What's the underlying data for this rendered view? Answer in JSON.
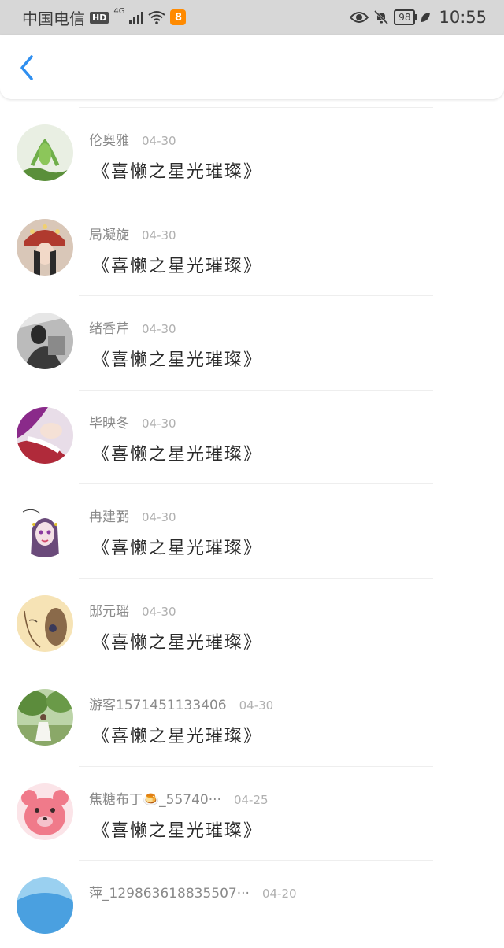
{
  "status_bar": {
    "carrier": "中国电信",
    "hd": "HD",
    "network": "4G",
    "app_badge": "8",
    "battery": "98",
    "time": "10:55"
  },
  "header": {
    "back_icon": "chevron-left-icon"
  },
  "list": [
    {
      "name": "伦奥雅",
      "date": "04-30",
      "message": "《喜懒之星光璀璨》",
      "avatar_color": "#6fae4a"
    },
    {
      "name": "局凝旋",
      "date": "04-30",
      "message": "《喜懒之星光璀璨》",
      "avatar_color": "#9a3b2e"
    },
    {
      "name": "绪香芹",
      "date": "04-30",
      "message": "《喜懒之星光璀璨》",
      "avatar_color": "#3a3a3a"
    },
    {
      "name": "毕映冬",
      "date": "04-30",
      "message": "《喜懒之星光璀璨》",
      "avatar_color": "#b04a8a"
    },
    {
      "name": "冉建弼",
      "date": "04-30",
      "message": "《喜懒之星光璀璨》",
      "avatar_color": "#c9a9d9"
    },
    {
      "name": "邸元瑶",
      "date": "04-30",
      "message": "《喜懒之星光璀璨》",
      "avatar_color": "#f6e3b5"
    },
    {
      "name": "游客1571451133406",
      "date": "04-30",
      "message": "《喜懒之星光璀璨》",
      "avatar_color": "#5c8c3c"
    },
    {
      "name": "焦糖布丁🍮_55740···",
      "date": "04-25",
      "message": "《喜懒之星光璀璨》",
      "avatar_color": "#f07a8a"
    },
    {
      "name": "萍_129863618835507···",
      "date": "04-20",
      "message": "",
      "avatar_color": "#4aa0e0"
    }
  ]
}
